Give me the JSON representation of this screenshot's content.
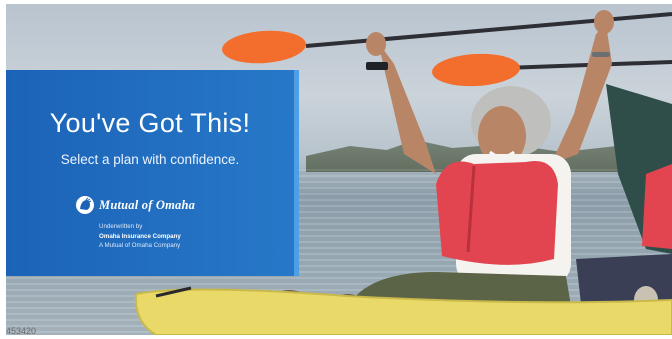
{
  "banner": {
    "headline": "You've Got This!",
    "subheadline": "Select a plan with confidence.",
    "brand_name": "Mutual of Omaha",
    "underwritten_label": "Underwritten by",
    "underwriter": "Omaha Insurance Company",
    "underwriter_note": "A Mutual of Omaha Company",
    "photo_id": "453420"
  },
  "colors": {
    "panel_blue": "#2272c3",
    "panel_border": "#4da0e6",
    "paddle_orange": "#f36d2c",
    "life_vest_red": "#e2454f",
    "kayak_yellow": "#e8d968"
  },
  "icons": {
    "brand_logo": "native-chief-head-logo"
  }
}
